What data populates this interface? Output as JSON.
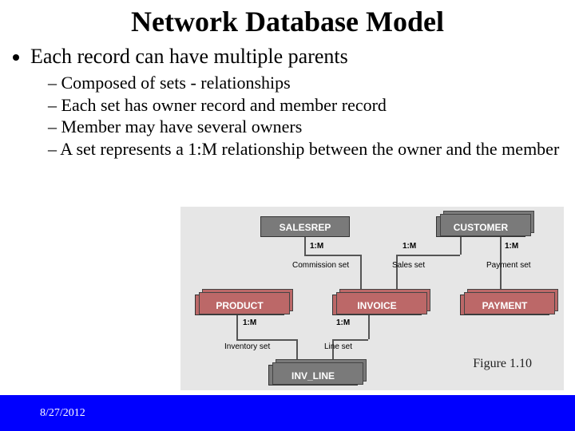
{
  "slide": {
    "title": "Network Database Model",
    "bullet": "Each record can have multiple parents",
    "subs": [
      "Composed of sets - relationships",
      "Each set has owner record and member record",
      "Member may have several owners",
      "A set represents a 1:M relationship between the owner and the member"
    ],
    "figure_caption": "Figure 1.10",
    "footer_date": "8/27/2012"
  },
  "diagram": {
    "nodes": {
      "salesrep": "SALESREP",
      "customer": "CUSTOMER",
      "product": "PRODUCT",
      "invoice": "INVOICE",
      "payment": "PAYMENT",
      "inv_line": "INV_LINE"
    },
    "edges": {
      "commission": {
        "rel": "1:M",
        "label": "Commission set"
      },
      "sales": {
        "rel": "1:M",
        "label": "Sales set"
      },
      "payment": {
        "rel": "1:M",
        "label": "Payment set"
      },
      "inventory": {
        "rel": "1:M",
        "label": "Inventory set"
      },
      "line": {
        "rel": "1:M",
        "label": "Line set"
      }
    }
  }
}
